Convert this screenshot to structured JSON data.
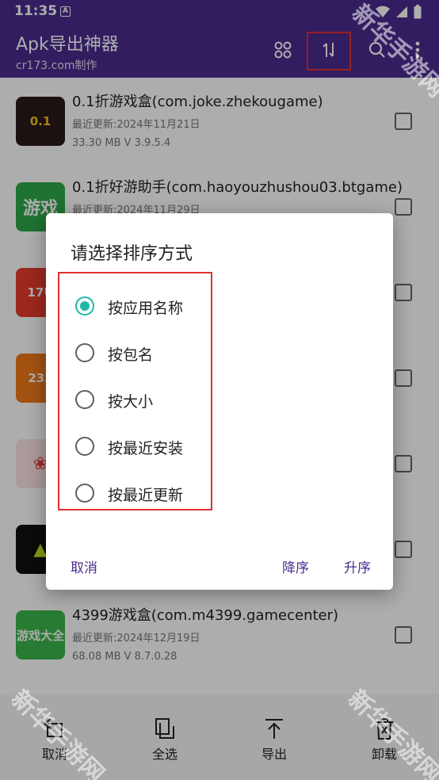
{
  "status_bar": {
    "time": "11:35",
    "badge": "A"
  },
  "app_bar": {
    "title": "Apk导出神器",
    "subtitle": "cr173.com制作",
    "icons": [
      "grid-icon",
      "sort-icon",
      "search-icon",
      "more-vert-icon"
    ]
  },
  "apps": [
    {
      "name": "0.1折游戏盒(com.joke.zhekougame)",
      "date": "最近更新:2024年11月21日",
      "size": "33.30 MB   V 3.9.5.4",
      "logo_text": "0.1",
      "logo_bg": "#2a1a1a",
      "logo_fg": "#f0c020"
    },
    {
      "name": "0.1折好游助手(com.haoyouzhushou03.btgame)",
      "date": "最近更新:2024年11月29日",
      "size": "",
      "logo_text": "游戏",
      "logo_bg": "#2ea84a",
      "logo_fg": "#ffffff"
    },
    {
      "name": "",
      "date": "",
      "size": "",
      "logo_text": "17U",
      "logo_bg": "#e63c2e",
      "logo_fg": "#ffffff"
    },
    {
      "name": "",
      "date": "",
      "size": "",
      "logo_text": "233",
      "logo_bg": "#f07a1a",
      "logo_fg": "#ffffff"
    },
    {
      "name": "",
      "date": "",
      "size": "",
      "logo_text": "❀",
      "logo_bg": "#fbe3e3",
      "logo_fg": "#e04040"
    },
    {
      "name": "",
      "date": "",
      "size": "",
      "logo_text": "▲",
      "logo_bg": "#111111",
      "logo_fg": "#c8e020"
    },
    {
      "name": "4399游戏盒(com.m4399.gamecenter)",
      "date": "最近更新:2024年12月19日",
      "size": "68.08 MB   V 8.7.0.28",
      "logo_text": "游戏大全",
      "logo_bg": "#3bb54a",
      "logo_fg": "#ffffff"
    }
  ],
  "bottom_bar": {
    "cancel": "取消",
    "select_all": "全选",
    "export": "导出",
    "uninstall": "卸载"
  },
  "dialog": {
    "title": "请选择排序方式",
    "options": [
      "按应用名称",
      "按包名",
      "按大小",
      "按最近安装",
      "按最近更新"
    ],
    "selected_index": 0,
    "cancel": "取消",
    "descending": "降序",
    "ascending": "升序"
  },
  "colors": {
    "primary": "#4a2c8f",
    "accent": "#1fb7a7",
    "highlight": "#e03030"
  },
  "watermark": "新华手游网"
}
